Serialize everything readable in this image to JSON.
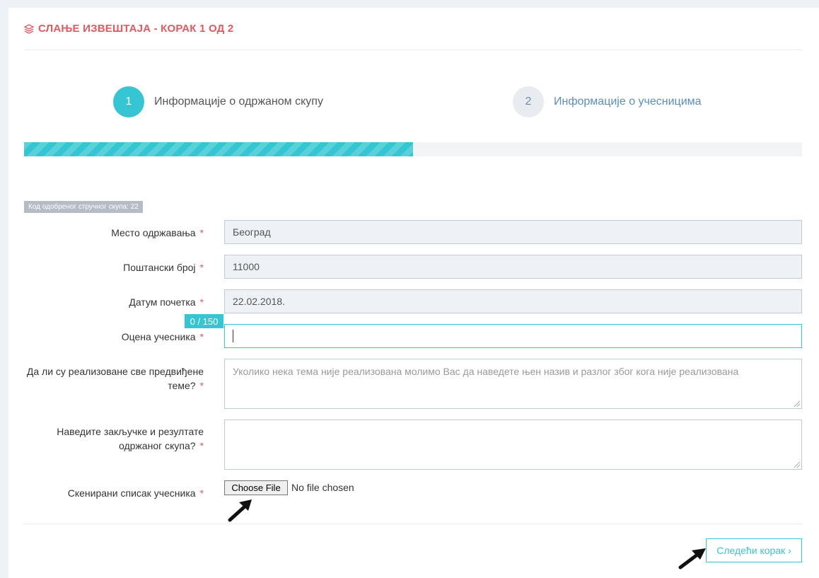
{
  "header": {
    "title": "СЛАЊЕ ИЗВЕШТАЈА - КОРАК 1 ОД 2",
    "icon": "layers-icon"
  },
  "steps": [
    {
      "number": "1",
      "label": "Информације о одржаном скупу",
      "active": true
    },
    {
      "number": "2",
      "label": "Информације о учесницима",
      "active": false
    }
  ],
  "progress": {
    "percent": 50
  },
  "code_badge": "Код одобреног стручног скупа: 22",
  "form": {
    "required_mark": "*",
    "location": {
      "label": "Место одржавања",
      "value": "Београд"
    },
    "postal": {
      "label": "Поштански број",
      "value": "11000"
    },
    "start_date": {
      "label": "Датум почетка",
      "value": "22.02.2018."
    },
    "rating": {
      "label": "Оцена учесника",
      "value": "",
      "counter": "0 / 150"
    },
    "topics": {
      "label": "Да ли су реализоване све предвиђене теме?",
      "placeholder": "Уколико нека тема није реализована молимо Вас да наведете њен назив и разлог због кога није реализована"
    },
    "conclusions": {
      "label": "Наведите закључке и резултате одржаног скупа?",
      "value": ""
    },
    "scanned_list": {
      "label": "Скенирани списак учесника",
      "button": "Choose File",
      "status": "No file chosen"
    }
  },
  "next_button": {
    "label": "Следећи корак ›"
  },
  "colors": {
    "accent": "#36c6d3",
    "title": "#e05a5f",
    "required": "#e05a5f"
  }
}
